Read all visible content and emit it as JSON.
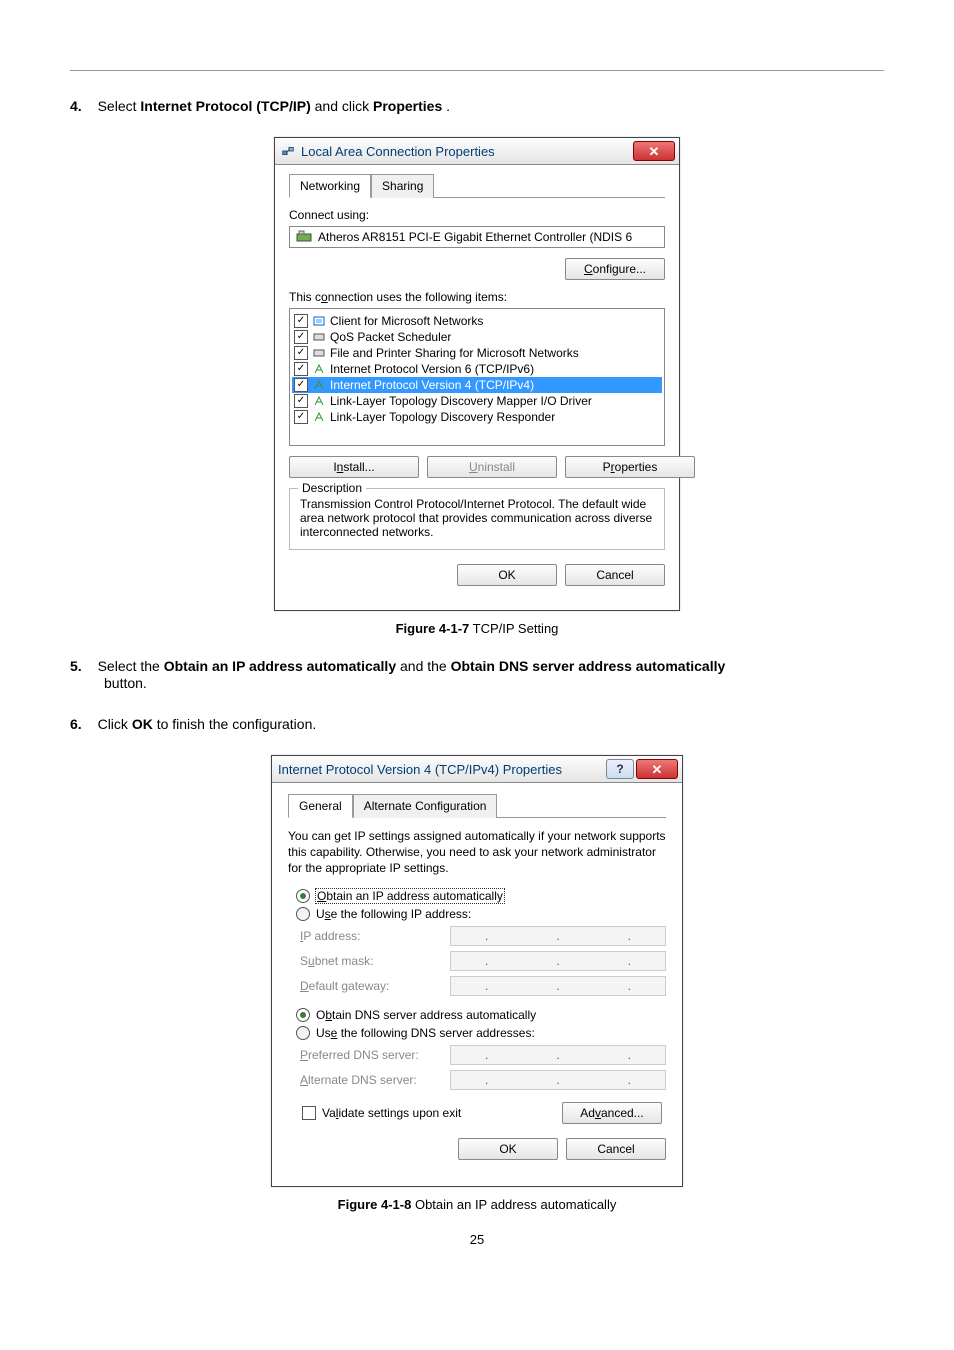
{
  "steps": {
    "s4_num": "4.",
    "s4_pre": "Select ",
    "s4_bold1": "Internet Protocol (TCP/IP)",
    "s4_mid": " and click ",
    "s4_bold2": "Properties",
    "s4_post": ".",
    "s5_num": "5.",
    "s5_pre": "Select the ",
    "s5_bold1": "Obtain an IP address automatically",
    "s5_mid": " and the ",
    "s5_bold2": "Obtain DNS server address automatically",
    "s5_line2": "button.",
    "s6_num": "6.",
    "s6_pre": "Click ",
    "s6_bold1": "OK",
    "s6_post": " to finish the configuration."
  },
  "fig1": {
    "bold": "Figure 4-1-7",
    "rest": " TCP/IP Setting"
  },
  "fig2": {
    "bold": "Figure 4-1-8",
    "rest": " Obtain an IP address automatically"
  },
  "dlg1": {
    "title": "Local Area Connection Properties",
    "close": "✕",
    "tabs": {
      "networking": "Networking",
      "sharing": "Sharing"
    },
    "connect_using_label": "Connect using:",
    "adapter": "Atheros AR8151 PCI-E Gigabit Ethernet Controller (NDIS 6",
    "configure": "Configure...",
    "items_label": "This connection uses the following items:",
    "items": [
      "Client for Microsoft Networks",
      "QoS Packet Scheduler",
      "File and Printer Sharing for Microsoft Networks",
      "Internet Protocol Version 6 (TCP/IPv6)",
      "Internet Protocol Version 4 (TCP/IPv4)",
      "Link-Layer Topology Discovery Mapper I/O Driver",
      "Link-Layer Topology Discovery Responder"
    ],
    "install": "Install...",
    "uninstall": "Uninstall",
    "properties": "Properties",
    "desc_legend": "Description",
    "desc_text": "Transmission Control Protocol/Internet Protocol. The default wide area network protocol that provides communication across diverse interconnected networks.",
    "ok": "OK",
    "cancel": "Cancel"
  },
  "dlg2": {
    "title": "Internet Protocol Version 4 (TCP/IPv4) Properties",
    "help": "?",
    "close": "✕",
    "tabs": {
      "general": "General",
      "alt": "Alternate Configuration"
    },
    "info": "You can get IP settings assigned automatically if your network supports this capability. Otherwise, you need to ask your network administrator for the appropriate IP settings.",
    "r_obtain_ip": "Obtain an IP address automatically",
    "r_use_ip": "Use the following IP address:",
    "ip_address": "IP address:",
    "subnet": "Subnet mask:",
    "gateway": "Default gateway:",
    "r_obtain_dns": "Obtain DNS server address automatically",
    "r_use_dns": "Use the following DNS server addresses:",
    "pref_dns": "Preferred DNS server:",
    "alt_dns": "Alternate DNS server:",
    "validate": "Validate settings upon exit",
    "advanced": "Advanced...",
    "ok": "OK",
    "cancel": "Cancel"
  },
  "page_number": "25"
}
